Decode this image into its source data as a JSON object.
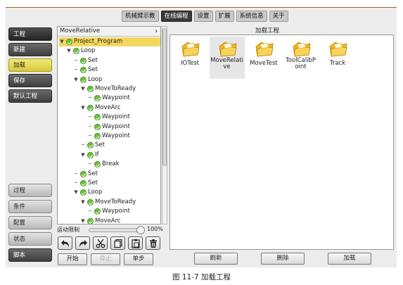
{
  "topbar": {
    "tabs": [
      "机械臂示教",
      "在线编程",
      "设置",
      "扩展",
      "系统信息",
      "关于"
    ],
    "active": "在线编程"
  },
  "sidebar": {
    "header": "工程",
    "items": [
      "新建",
      "加载",
      "保存",
      "默认工程"
    ],
    "active_item": "加载",
    "bottom_items": [
      "过程",
      "条件",
      "配置",
      "状态",
      "脚本"
    ]
  },
  "tree": {
    "header": "MoveRelative",
    "nodes": [
      {
        "label": "Project_Program",
        "depth": 0,
        "expand": true,
        "selected": true
      },
      {
        "label": "Loop",
        "depth": 1,
        "expand": true
      },
      {
        "label": "Set",
        "depth": 2
      },
      {
        "label": "Set",
        "depth": 2
      },
      {
        "label": "Loop",
        "depth": 2,
        "expand": true
      },
      {
        "label": "MoveToReady",
        "depth": 3,
        "expand": true
      },
      {
        "label": "Waypoint",
        "depth": 4
      },
      {
        "label": "MoveArc",
        "depth": 3,
        "expand": true
      },
      {
        "label": "Waypoint",
        "depth": 4
      },
      {
        "label": "Waypoint",
        "depth": 4
      },
      {
        "label": "Waypoint",
        "depth": 4
      },
      {
        "label": "Set",
        "depth": 3
      },
      {
        "label": "If",
        "depth": 3,
        "expand": true
      },
      {
        "label": "Break",
        "depth": 4
      },
      {
        "label": "Set",
        "depth": 2
      },
      {
        "label": "Set",
        "depth": 2
      },
      {
        "label": "Loop",
        "depth": 2,
        "expand": true
      },
      {
        "label": "MoveToReady",
        "depth": 3,
        "expand": true
      },
      {
        "label": "Waypoint",
        "depth": 4
      },
      {
        "label": "MoveArc",
        "depth": 3,
        "expand": true
      }
    ]
  },
  "speed": {
    "label": "运动限制",
    "value": "100%",
    "level": 1.0
  },
  "toolbar_icons": [
    "undo-icon",
    "redo-icon",
    "cut-icon",
    "copy-icon",
    "paste-icon",
    "delete-icon"
  ],
  "run_buttons": {
    "start": "开始",
    "stop": "停止",
    "step": "单步"
  },
  "main": {
    "title": "加载工程",
    "projects": [
      "IOTest",
      "MoveRelative",
      "MoveTest",
      "ToolCalibPoint",
      "Track"
    ],
    "project_lines": [
      [
        "IOTest"
      ],
      [
        "MoveRelati",
        "ve"
      ],
      [
        "MoveTest"
      ],
      [
        "ToolCalibP",
        "oint"
      ],
      [
        "Track"
      ]
    ],
    "selected_project": "MoveRelative",
    "buttons": {
      "refresh": "刷新",
      "delete": "删除",
      "load": "加载"
    }
  },
  "caption": "图 11-7 加载工程",
  "colors": {
    "selection": "#f3d860",
    "check": "#6cc43a",
    "folder": "#f0b820"
  }
}
